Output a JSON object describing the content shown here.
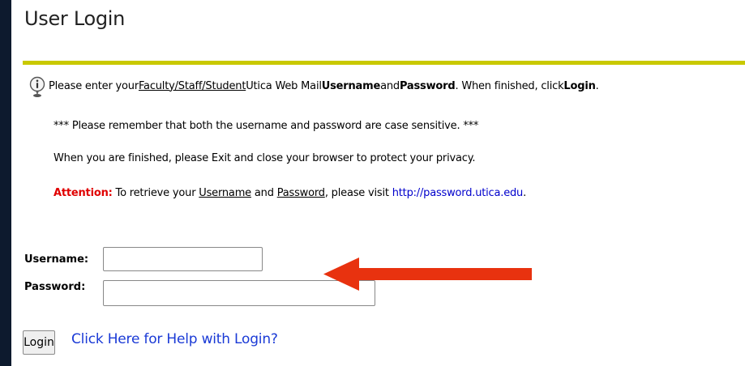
{
  "page": {
    "title": "User Login"
  },
  "info": {
    "prefix": "Please enter your ",
    "faculty_link": "Faculty/Staff/Student",
    "middle1": " Utica Web Mail ",
    "username_bold": "Username",
    "and": " and ",
    "password_bold": "Password",
    "middle2": ". When finished, click ",
    "login_bold": "Login",
    "end": "."
  },
  "notes": {
    "case_sensitive": "*** Please remember that both the username and password are case sensitive. ***",
    "exit_privacy": "When you are finished, please Exit and close your browser to protect your privacy."
  },
  "attention": {
    "label": "Attention:",
    "text1": " To retrieve your ",
    "username_link": "Username",
    "and": " and ",
    "password_link": "Password",
    "text2": ", please visit ",
    "url": "http://password.utica.edu",
    "end": "."
  },
  "form": {
    "username_label": "Username:",
    "username_value": "",
    "password_label": "Password:",
    "password_value": "",
    "login_button": "Login",
    "help_link": "Click Here for Help with Login?"
  },
  "colors": {
    "accent_rule": "#c9c900",
    "attention": "#e00000",
    "link": "#1a3ad6",
    "arrow": "#e8320f",
    "frame": "#0d1a2e"
  },
  "icons": {
    "info": "info-icon",
    "annotation_arrow": "arrow-left-icon"
  }
}
